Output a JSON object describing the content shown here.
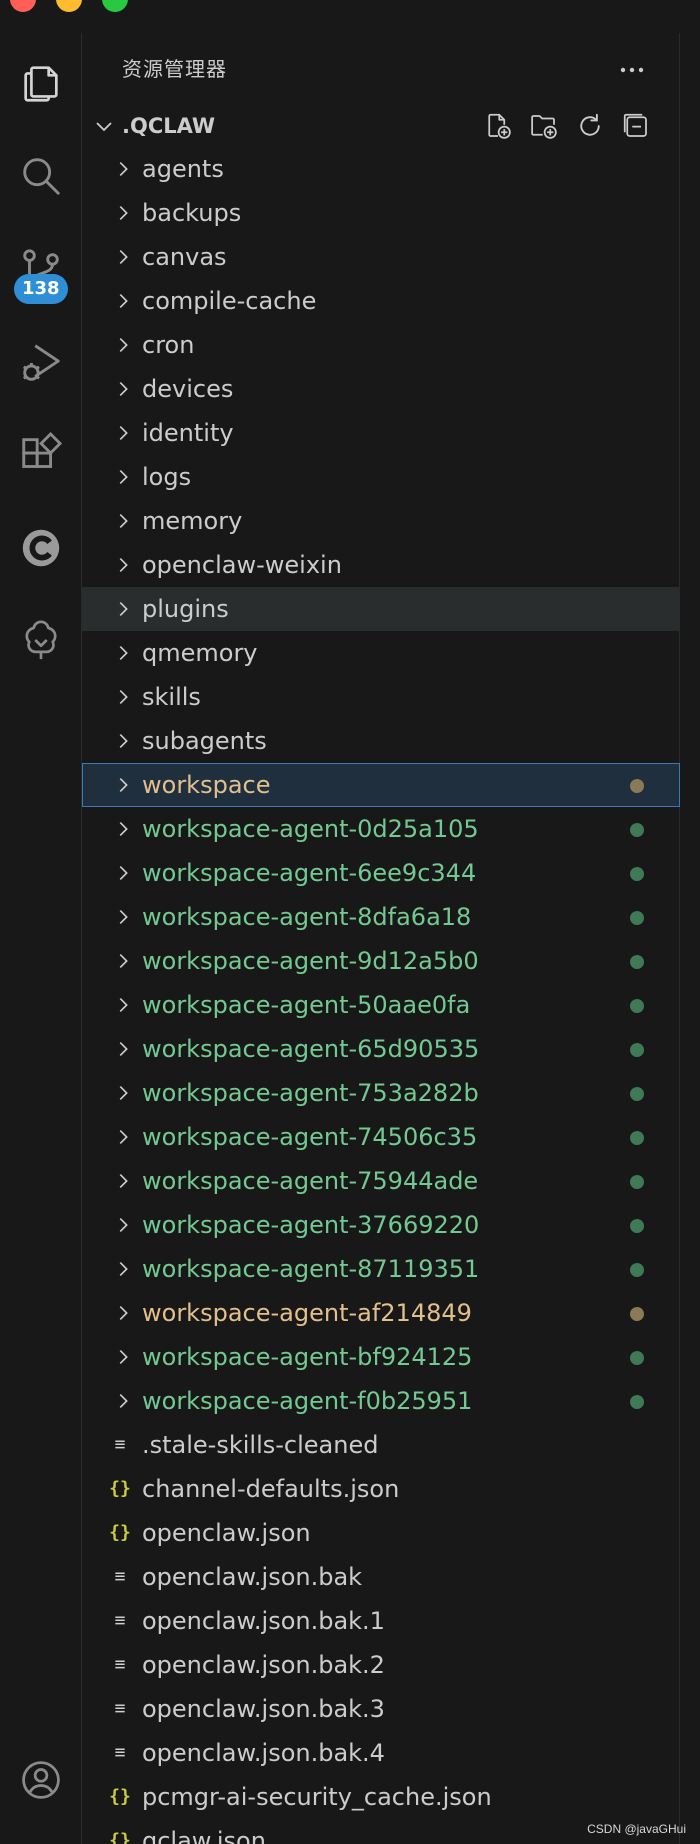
{
  "colors": {
    "window_bg": "#181818",
    "badge": "#2f8fd6",
    "modified": "#e2c08d",
    "untracked": "#73c991",
    "folder_text": "#cccccc",
    "selection_border": "#3a7ab8",
    "traffic_close": "#ff5f57",
    "traffic_min": "#febc2e",
    "traffic_max": "#28c840"
  },
  "activity_bar": {
    "items": [
      {
        "name": "explorer",
        "icon": "files-icon"
      },
      {
        "name": "search",
        "icon": "search-icon"
      },
      {
        "name": "source-control",
        "icon": "source-control-icon"
      },
      {
        "name": "run-debug",
        "icon": "run-debug-icon"
      },
      {
        "name": "extensions",
        "icon": "extensions-icon"
      },
      {
        "name": "codeium",
        "icon": "codeium-icon"
      },
      {
        "name": "gitlens",
        "icon": "tree-icon"
      }
    ],
    "source_control_badge": "138",
    "account_icon": "account-icon"
  },
  "sidebar": {
    "title": "资源管理器",
    "more_icon": "ellipsis-icon"
  },
  "root": {
    "label": ".QCLAW",
    "actions": [
      "new-file-icon",
      "new-folder-icon",
      "refresh-icon",
      "collapse-all-icon"
    ]
  },
  "tree": {
    "items": [
      {
        "label": "agents",
        "kind": "folder",
        "status": ""
      },
      {
        "label": "backups",
        "kind": "folder",
        "status": ""
      },
      {
        "label": "canvas",
        "kind": "folder",
        "status": ""
      },
      {
        "label": "compile-cache",
        "kind": "folder",
        "status": ""
      },
      {
        "label": "cron",
        "kind": "folder",
        "status": ""
      },
      {
        "label": "devices",
        "kind": "folder",
        "status": ""
      },
      {
        "label": "identity",
        "kind": "folder",
        "status": ""
      },
      {
        "label": "logs",
        "kind": "folder",
        "status": ""
      },
      {
        "label": "memory",
        "kind": "folder",
        "status": ""
      },
      {
        "label": "openclaw-weixin",
        "kind": "folder",
        "status": ""
      },
      {
        "label": "plugins",
        "kind": "folder",
        "status": "",
        "state": "hover"
      },
      {
        "label": "qmemory",
        "kind": "folder",
        "status": ""
      },
      {
        "label": "skills",
        "kind": "folder",
        "status": ""
      },
      {
        "label": "subagents",
        "kind": "folder",
        "status": ""
      },
      {
        "label": "workspace",
        "kind": "folder",
        "status": "modified",
        "state": "selected"
      },
      {
        "label": "workspace-agent-0d25a105",
        "kind": "folder",
        "status": "untracked"
      },
      {
        "label": "workspace-agent-6ee9c344",
        "kind": "folder",
        "status": "untracked"
      },
      {
        "label": "workspace-agent-8dfa6a18",
        "kind": "folder",
        "status": "untracked"
      },
      {
        "label": "workspace-agent-9d12a5b0",
        "kind": "folder",
        "status": "untracked"
      },
      {
        "label": "workspace-agent-50aae0fa",
        "kind": "folder",
        "status": "untracked"
      },
      {
        "label": "workspace-agent-65d90535",
        "kind": "folder",
        "status": "untracked"
      },
      {
        "label": "workspace-agent-753a282b",
        "kind": "folder",
        "status": "untracked"
      },
      {
        "label": "workspace-agent-74506c35",
        "kind": "folder",
        "status": "untracked"
      },
      {
        "label": "workspace-agent-75944ade",
        "kind": "folder",
        "status": "untracked"
      },
      {
        "label": "workspace-agent-37669220",
        "kind": "folder",
        "status": "untracked"
      },
      {
        "label": "workspace-agent-87119351",
        "kind": "folder",
        "status": "untracked"
      },
      {
        "label": "workspace-agent-af214849",
        "kind": "folder",
        "status": "modified"
      },
      {
        "label": "workspace-agent-bf924125",
        "kind": "folder",
        "status": "untracked"
      },
      {
        "label": "workspace-agent-f0b25951",
        "kind": "folder",
        "status": "untracked"
      },
      {
        "label": ".stale-skills-cleaned",
        "kind": "text",
        "status": ""
      },
      {
        "label": "channel-defaults.json",
        "kind": "json",
        "status": ""
      },
      {
        "label": "openclaw.json",
        "kind": "json",
        "status": ""
      },
      {
        "label": "openclaw.json.bak",
        "kind": "text",
        "status": ""
      },
      {
        "label": "openclaw.json.bak.1",
        "kind": "text",
        "status": ""
      },
      {
        "label": "openclaw.json.bak.2",
        "kind": "text",
        "status": ""
      },
      {
        "label": "openclaw.json.bak.3",
        "kind": "text",
        "status": ""
      },
      {
        "label": "openclaw.json.bak.4",
        "kind": "text",
        "status": ""
      },
      {
        "label": "pcmgr-ai-security_cache.json",
        "kind": "json",
        "status": ""
      },
      {
        "label": "qclaw.json",
        "kind": "json",
        "status": ""
      }
    ]
  },
  "watermark": "CSDN @javaGHui"
}
